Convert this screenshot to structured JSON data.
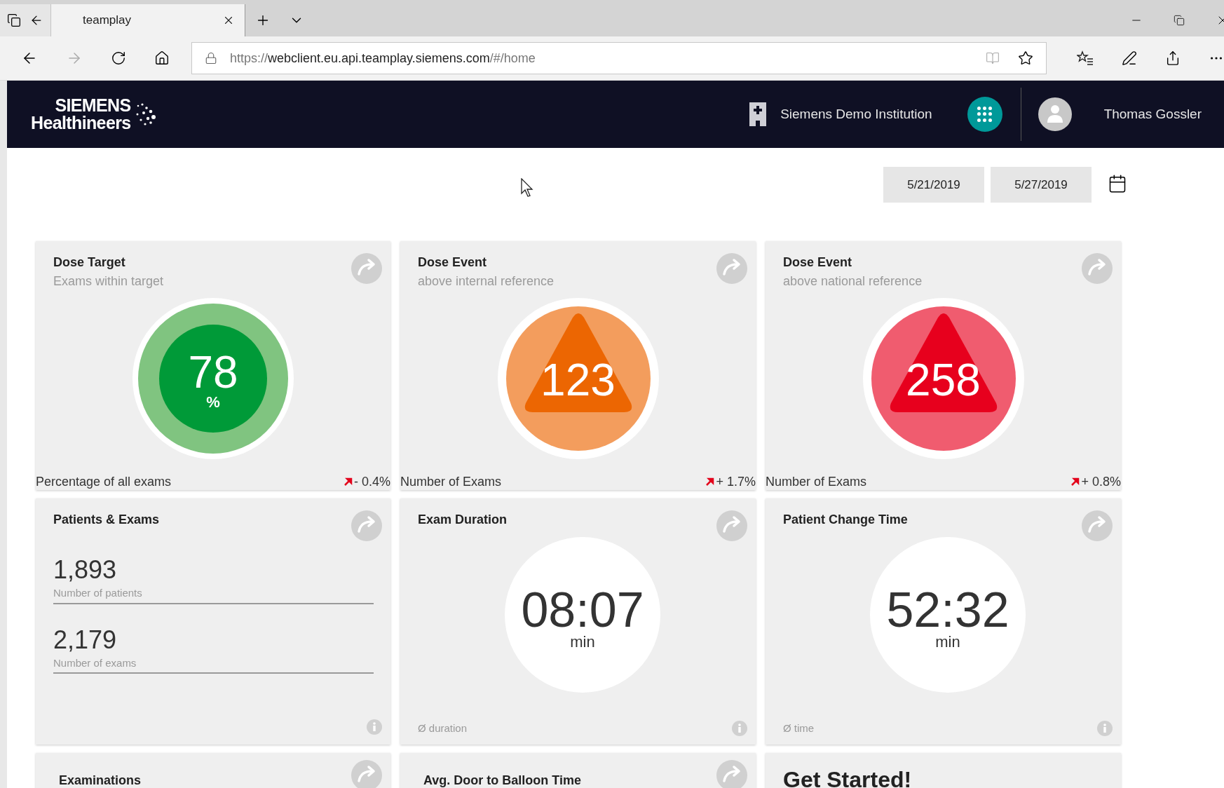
{
  "browser": {
    "tabs": [
      {
        "title": "teamplay",
        "selected": true
      }
    ],
    "url": {
      "scheme": "https://",
      "host": "webclient.eu.api.teamplay.siemens.com",
      "path": "/#/home"
    }
  },
  "header": {
    "logo": [
      "SIEMENS",
      "Healthineers"
    ],
    "institution": "Siemens Demo Institution",
    "user": "Thomas Gossler"
  },
  "dates": [
    "5/21/2019",
    "5/27/2019"
  ],
  "cards": [
    {
      "kind": "dose_target",
      "title": "Dose Target",
      "subtitle": "Exams within target",
      "value": "78",
      "unit": "%",
      "footer": "Percentage of all exams",
      "trend": "- 0.4%"
    },
    {
      "kind": "dose_event",
      "color": "#ec6602",
      "title": "Dose Event",
      "subtitle": "above internal reference",
      "value": "123",
      "footer": "Number of Exams",
      "trend": "+ 1.7%"
    },
    {
      "kind": "dose_event",
      "color": "#e7001d",
      "title": "Dose Event",
      "subtitle": "above national reference",
      "value": "258",
      "footer": "Number of Exams",
      "trend": "+ 0.8%"
    },
    {
      "kind": "counts",
      "title": "Patients & Exams",
      "stats": [
        {
          "value": "1,893",
          "label": "Number of patients"
        },
        {
          "value": "2,179",
          "label": "Number of exams"
        }
      ]
    },
    {
      "kind": "time",
      "title": "Exam Duration",
      "value": "08:07",
      "unit": "min",
      "footer": "Ø duration"
    },
    {
      "kind": "time",
      "title": "Patient Change Time",
      "value": "52:32",
      "unit": "min",
      "footer": "Ø time"
    },
    {
      "kind": "teaser",
      "title": "Examinations"
    },
    {
      "kind": "teaser",
      "title": "Avg. Door to Balloon Time"
    },
    {
      "kind": "get_started",
      "title": "Get Started!"
    }
  ]
}
